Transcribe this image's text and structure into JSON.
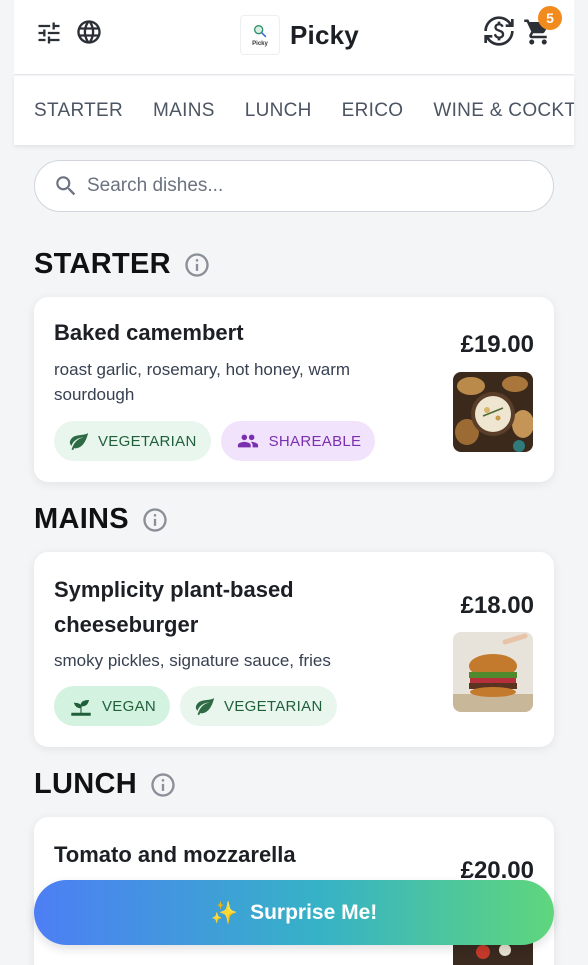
{
  "header": {
    "app_name": "Picky",
    "logo_text": "Picky",
    "cart_count": "5",
    "icons": [
      "filters-icon",
      "language-globe-icon",
      "currency-exchange-icon",
      "cart-icon"
    ]
  },
  "tabs": [
    "STARTER",
    "MAINS",
    "LUNCH",
    "ERICO",
    "WINE & COCKTAILS"
  ],
  "search": {
    "placeholder": "Search dishes..."
  },
  "sections": [
    {
      "title": "STARTER",
      "dishes": [
        {
          "name": "Baked camembert",
          "description": "roast garlic, rosemary, hot honey, warm sourdough",
          "price": "£19.00",
          "tags": [
            "VEGETARIAN",
            "SHAREABLE"
          ]
        }
      ]
    },
    {
      "title": "MAINS",
      "dishes": [
        {
          "name": "Symplicity plant-based cheeseburger",
          "description": "smoky pickles, signature sauce, fries",
          "price": "£18.00",
          "tags": [
            "VEGAN",
            "VEGETARIAN"
          ]
        }
      ]
    },
    {
      "title": "LUNCH",
      "dishes": [
        {
          "name": "Tomato and mozzarella",
          "price": "£20.00"
        }
      ]
    }
  ],
  "surprise_button": {
    "emoji": "✨",
    "label": "Surprise Me!"
  },
  "colors": {
    "cart_badge": "#f28b1d",
    "vegetarian_tag_bg": "#e8f6ee",
    "vegan_tag_bg": "#d3f2e0",
    "shareable_tag_bg": "#f1e3fb",
    "shareable_tag_text": "#7a2fb0",
    "surprise_gradient_start": "#4d7ef5",
    "surprise_gradient_end": "#5fd67c"
  }
}
